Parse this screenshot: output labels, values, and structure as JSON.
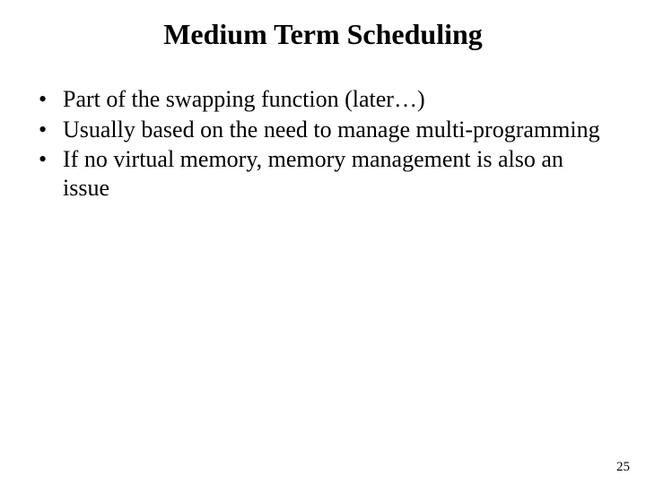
{
  "slide": {
    "title": "Medium Term Scheduling",
    "bullets": [
      "Part of the swapping function (later…)",
      "Usually based on the need to manage multi-programming",
      "If no virtual memory, memory management is also an issue"
    ],
    "page_number": "25"
  }
}
